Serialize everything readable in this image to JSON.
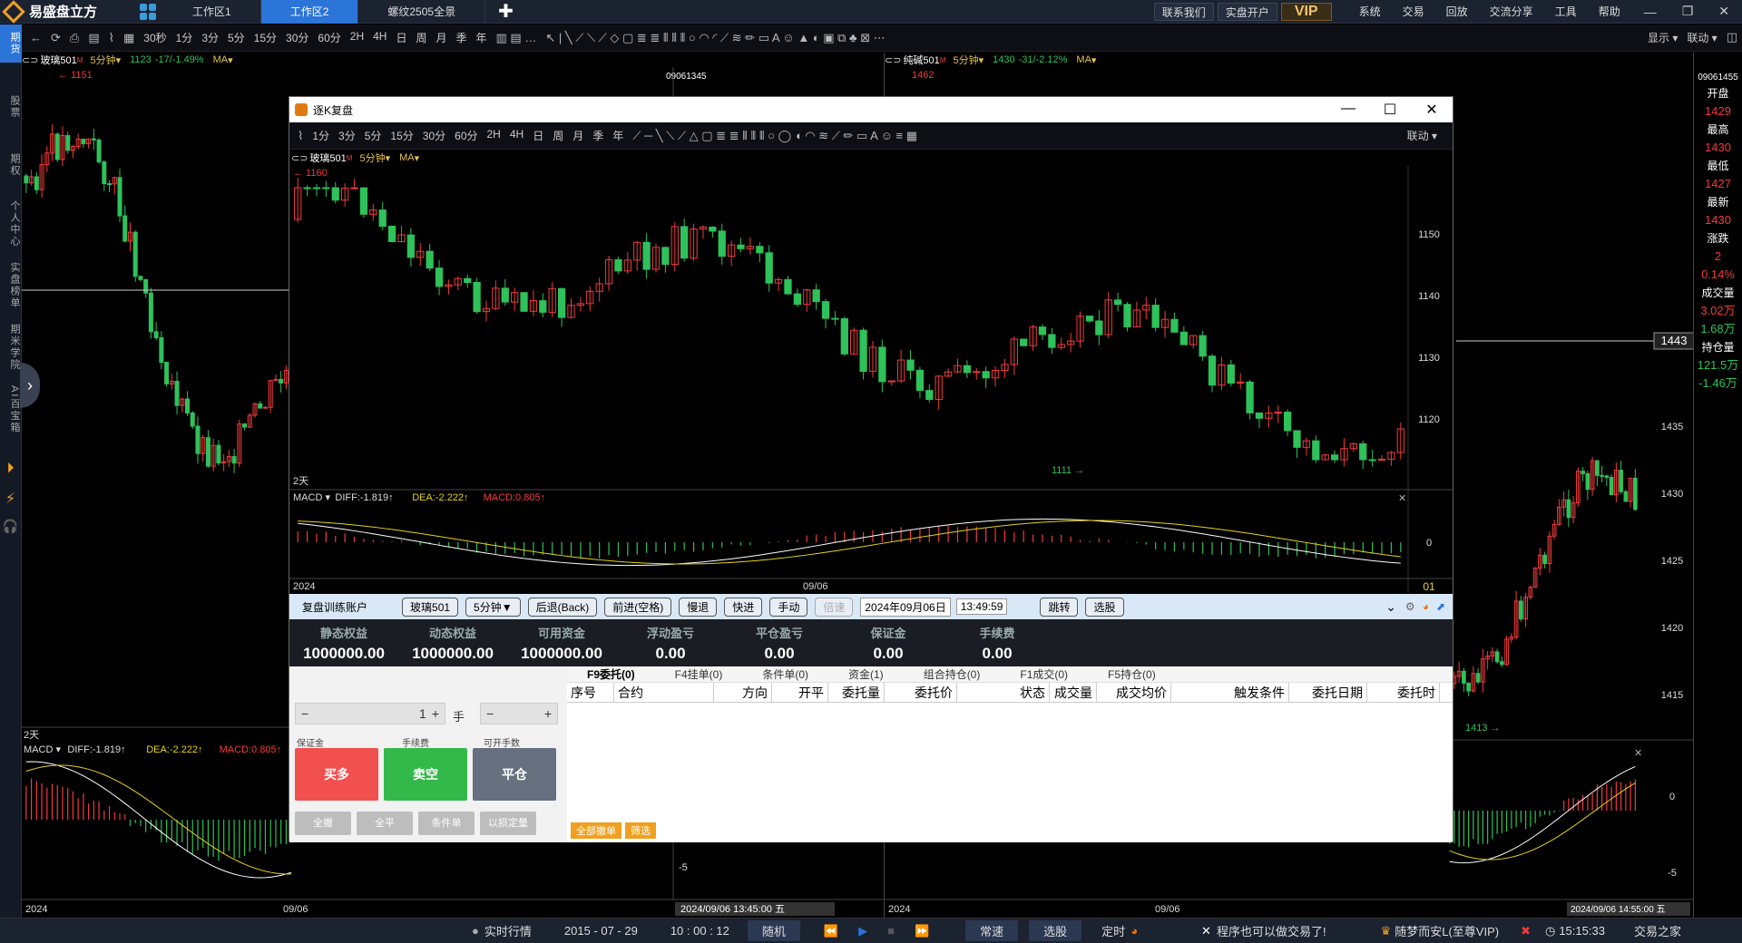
{
  "app": {
    "name": "易盛盘立方",
    "tabs": [
      {
        "label": "工作区1",
        "active": false
      },
      {
        "label": "工作区2",
        "active": true
      },
      {
        "label": "螺纹2505全景",
        "active": false
      }
    ],
    "top_buttons": [
      "联系我们",
      "实盘开户"
    ],
    "vip": "VIP",
    "menu": [
      "系统",
      "交易",
      "回放",
      "交流分享",
      "工具",
      "帮助"
    ]
  },
  "toolbar": {
    "periods": [
      "30秒",
      "1分",
      "3分",
      "5分",
      "15分",
      "30分",
      "60分",
      "2H",
      "4H",
      "日",
      "周",
      "月",
      "季",
      "年"
    ],
    "right": [
      "显示 ▾",
      "联动 ▾"
    ]
  },
  "sidebar": [
    "期货",
    "股票",
    "期权",
    "个人中心",
    "实盘榜单",
    "期米学院",
    "AI百宝箱"
  ],
  "left_chart": {
    "symbol": "玻璃501",
    "period": "5分钟",
    "price": "1123",
    "change": "-17/-1.49%",
    "indicator": "MA",
    "marker_high": "1151",
    "time_tag": "09061345",
    "day_label": "2天",
    "macd_label": "MACD",
    "diff": "DIFF:-1.819↑",
    "dea": "DEA:-2.222↑",
    "macd": "MACD:0.805↑",
    "axis_year": "2024",
    "axis_date": "09/06",
    "cursor_time": "2024/09/06 13:45:00 五",
    "macd_tick": "-5"
  },
  "right_chart": {
    "symbol": "纯碱501",
    "period": "5分钟",
    "price": "1430",
    "change": "-31/-2.12%",
    "indicator": "MA",
    "marker_high": "1462",
    "time_tag": "09061455",
    "marker_low": "1413",
    "cursor_price": "1443",
    "price_ticks": [
      "1435",
      "1430",
      "1425",
      "1420",
      "1415"
    ],
    "macd_ticks": [
      "0",
      "-5"
    ],
    "axis_year": "2024",
    "axis_date": "09/06",
    "cursor_time": "2024/09/06 14:55:00 五"
  },
  "quote": [
    {
      "label": "开盘",
      "value": "1429"
    },
    {
      "label": "最高",
      "value": "1430"
    },
    {
      "label": "最低",
      "value": "1427"
    },
    {
      "label": "最新",
      "value": "1430"
    },
    {
      "label": "涨跌",
      "value": "2"
    },
    {
      "label": "",
      "value": "0.14%"
    },
    {
      "label": "成交量",
      "value": "3.02万"
    },
    {
      "label": "",
      "value": "1.68万"
    },
    {
      "label": "持仓量",
      "value": "121.5万"
    },
    {
      "label": "",
      "value": "-1.46万"
    }
  ],
  "modal": {
    "title": "逐K复盘",
    "periods": [
      "1分",
      "3分",
      "5分",
      "15分",
      "30分",
      "60分",
      "2H",
      "4H",
      "日",
      "周",
      "月",
      "季",
      "年"
    ],
    "link": "联动 ▾",
    "symbol": "玻璃501",
    "period": "5分钟",
    "indicator": "MA",
    "marker_high": "1160",
    "marker_low": "1111",
    "price_ticks": [
      "1150",
      "1140",
      "1130",
      "1120"
    ],
    "day_label": "2天",
    "macd_label": "MACD",
    "diff": "DIFF:-1.819↑",
    "dea": "DEA:-2.222↑",
    "macd": "MACD:0.805↑",
    "macd_tick": "0",
    "axis_year": "2024",
    "axis_date": "09/06",
    "axis_end": "01"
  },
  "trade": {
    "account": "复盘训练账户",
    "symbol_btn": "玻璃501",
    "period_btn": "5分钟▼",
    "back_btn": "后退(Back)",
    "forward_btn": "前进(空格)",
    "slow_btn": "慢退",
    "fast_btn": "快进",
    "manual_btn": "手动",
    "speed_btn": "倍速",
    "date": "2024年09月06日",
    "time": "13:49:59",
    "jump_btn": "跳转",
    "select_btn": "选股",
    "summary": [
      {
        "label": "静态权益",
        "value": "1000000.00"
      },
      {
        "label": "动态权益",
        "value": "1000000.00"
      },
      {
        "label": "可用资金",
        "value": "1000000.00"
      },
      {
        "label": "浮动盈亏",
        "value": "0.00"
      },
      {
        "label": "平仓盈亏",
        "value": "0.00"
      },
      {
        "label": "保证金",
        "value": "0.00"
      },
      {
        "label": "手续费",
        "value": "0.00"
      }
    ],
    "qty": "1",
    "qty_unit": "手",
    "labels": [
      "保证金",
      "手续费",
      "可开手数"
    ],
    "buy": "买多",
    "sell": "卖空",
    "close": "平仓",
    "small_buttons": [
      "全撤",
      "全平",
      "条件单",
      "以损定量"
    ],
    "order_tabs": [
      "F9委托(0)",
      "F4挂单(0)",
      "条件单(0)",
      "资金(1)",
      "组合持仓(0)",
      "F1成交(0)",
      "F5持仓(0)"
    ],
    "columns": [
      "序号",
      "合约",
      "方向",
      "开平",
      "委托量",
      "委托价",
      "状态",
      "成交量",
      "成交均价",
      "触发条件",
      "委托日期",
      "委托时"
    ],
    "footer": [
      "全部撤单",
      "筛选"
    ]
  },
  "bottom": {
    "realtime": "实时行情",
    "date": "2015 - 07 - 29",
    "time": "10 : 00 : 12",
    "random": "随机",
    "speed": "常速",
    "select": "选股",
    "timer": "定时",
    "ticker": "程序也可以做交易了!",
    "user": "随梦而安L(至尊VIP)",
    "clock": "15:15:33",
    "expert": "交易之家"
  }
}
